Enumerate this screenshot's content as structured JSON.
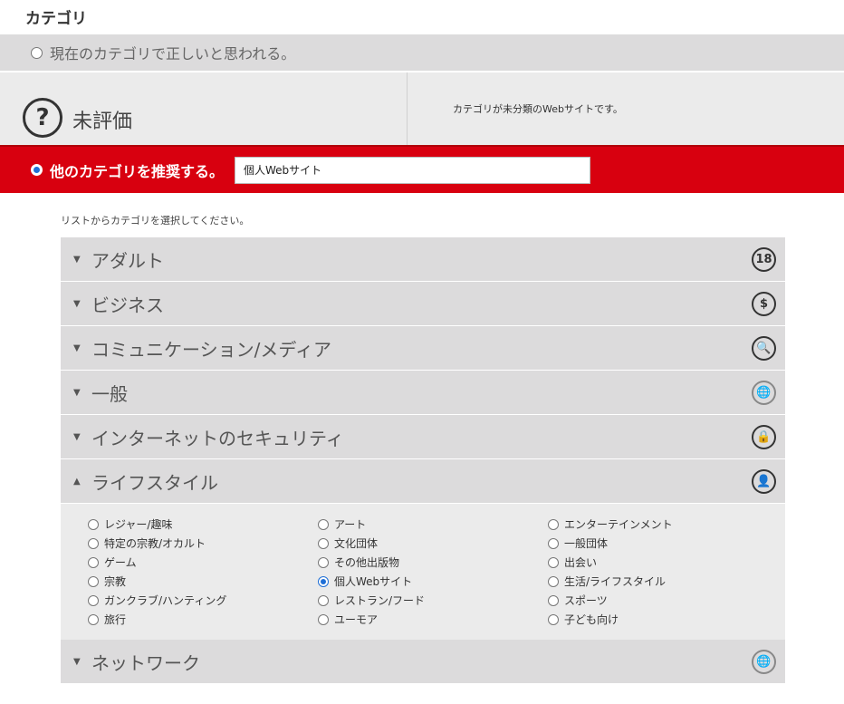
{
  "section_title": "カテゴリ",
  "current": {
    "label": "現在のカテゴリで正しいと思われる。",
    "checked": false
  },
  "rating": {
    "icon": "question-icon",
    "label": "未評価",
    "description": "カテゴリが未分類のWebサイトです。"
  },
  "suggest": {
    "label": "他のカテゴリを推奨する。",
    "checked": true,
    "input_value": "個人Webサイト"
  },
  "hint": "リストからカテゴリを選択してください。",
  "categories": [
    {
      "name": "アダルト",
      "arrow": "▼",
      "icon_glyph": "18",
      "icon": "age-18-icon"
    },
    {
      "name": "ビジネス",
      "arrow": "▼",
      "icon_glyph": "$",
      "icon": "dollar-icon"
    },
    {
      "name": "コミュニケーション/メディア",
      "arrow": "▼",
      "icon_glyph": "🔍",
      "icon": "media-search-icon"
    },
    {
      "name": "一般",
      "arrow": "▼",
      "icon_glyph": "🌐",
      "icon": "globe-icon"
    },
    {
      "name": "インターネットのセキュリティ",
      "arrow": "▼",
      "icon_glyph": "🔒",
      "icon": "lock-icon"
    },
    {
      "name": "ライフスタイル",
      "arrow": "▲",
      "icon_glyph": "👤",
      "icon": "lifestyle-icon",
      "expanded": true
    },
    {
      "name": "ネットワーク",
      "arrow": "▼",
      "icon_glyph": "🌐",
      "icon": "network-globe-icon"
    }
  ],
  "lifestyle_items": [
    [
      "レジャー/趣味",
      "アート",
      "エンターテインメント"
    ],
    [
      "特定の宗教/オカルト",
      "文化団体",
      "一般団体"
    ],
    [
      "ゲーム",
      "その他出版物",
      "出会い"
    ],
    [
      "宗教",
      "個人Webサイト",
      "生活/ライフスタイル"
    ],
    [
      "ガンクラブ/ハンティング",
      "レストラン/フード",
      "スポーツ"
    ],
    [
      "旅行",
      "ユーモア",
      "子ども向け"
    ]
  ],
  "lifestyle_selected": "個人Webサイト"
}
